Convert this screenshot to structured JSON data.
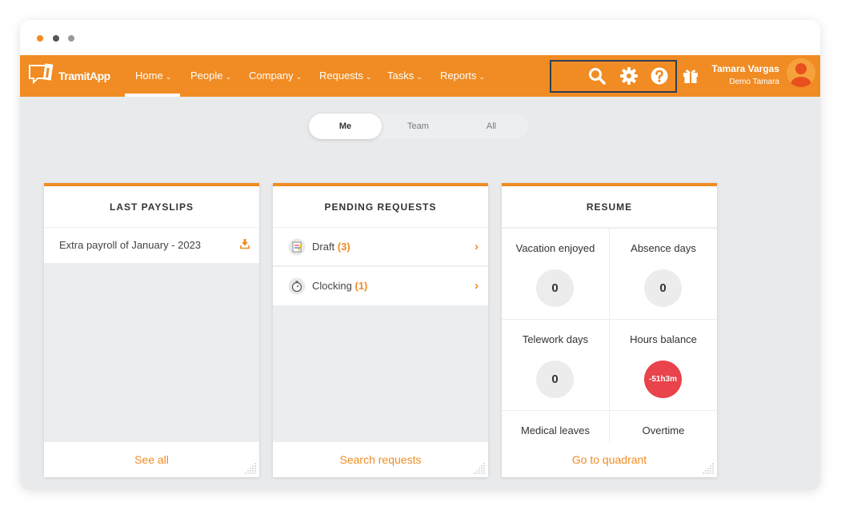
{
  "app": {
    "logo_text": "TramitApp",
    "brand_color": "#f08c23"
  },
  "nav": {
    "items": [
      {
        "label": "Home"
      },
      {
        "label": "People"
      },
      {
        "label": "Company"
      },
      {
        "label": "Requests"
      },
      {
        "label": "Tasks"
      },
      {
        "label": "Reports"
      }
    ],
    "active": "Home",
    "icons": [
      "search-icon",
      "gear-icon",
      "help-icon",
      "gift-icon"
    ]
  },
  "user": {
    "name": "Tamara Vargas",
    "company": "Demo Tamara"
  },
  "tabs": {
    "items": [
      {
        "label": "Me"
      },
      {
        "label": "Team"
      },
      {
        "label": "All"
      }
    ],
    "active": "Me"
  },
  "payslips": {
    "title": "LAST PAYSLIPS",
    "items": [
      {
        "label": "Extra payroll of January - 2023"
      }
    ],
    "footer": "See all"
  },
  "pending": {
    "title": "PENDING REQUESTS",
    "items": [
      {
        "label": "Draft",
        "count": "(3)"
      },
      {
        "label": "Clocking",
        "count": "(1)"
      }
    ],
    "footer": "Search requests"
  },
  "resume": {
    "title": "RESUME",
    "cells": [
      {
        "label": "Vacation enjoyed",
        "value": "0"
      },
      {
        "label": "Absence days",
        "value": "0"
      },
      {
        "label": "Telework days",
        "value": "0"
      },
      {
        "label": "Hours balance",
        "value": "-51h3m"
      },
      {
        "label": "Medical leaves"
      },
      {
        "label": "Overtime"
      }
    ],
    "footer": "Go to quadrant",
    "negative_color": "#e9434b"
  }
}
